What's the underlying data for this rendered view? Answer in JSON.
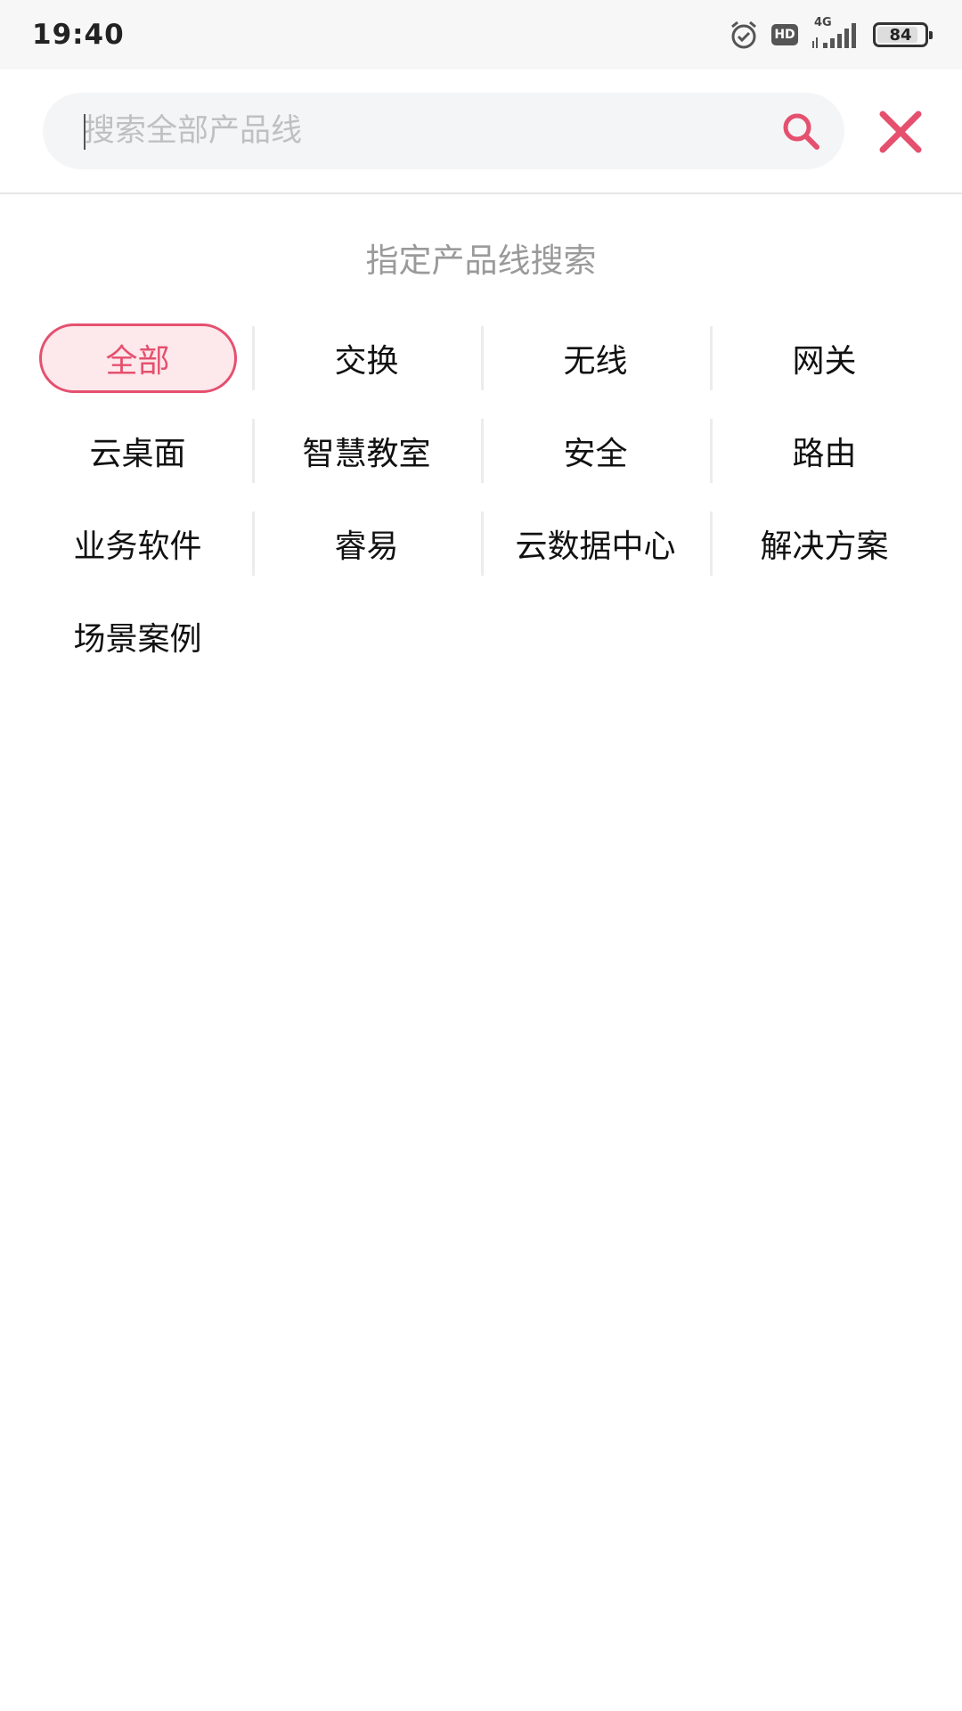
{
  "status_bar": {
    "time": "19:40",
    "network": "4G",
    "hd": "HD",
    "battery": "84",
    "icons": [
      "alarm-icon",
      "hd-icon",
      "signal-icon",
      "battery-icon"
    ]
  },
  "search": {
    "placeholder": "搜索全部产品线",
    "value": ""
  },
  "section": {
    "title": "指定产品线搜索"
  },
  "categories": [
    {
      "label": "全部",
      "active": true
    },
    {
      "label": "交换",
      "active": false
    },
    {
      "label": "无线",
      "active": false
    },
    {
      "label": "网关",
      "active": false
    },
    {
      "label": "云桌面",
      "active": false
    },
    {
      "label": "智慧教室",
      "active": false
    },
    {
      "label": "安全",
      "active": false
    },
    {
      "label": "路由",
      "active": false
    },
    {
      "label": "业务软件",
      "active": false
    },
    {
      "label": "睿易",
      "active": false
    },
    {
      "label": "云数据中心",
      "active": false
    },
    {
      "label": "解决方案",
      "active": false
    },
    {
      "label": "场景案例",
      "active": false
    }
  ],
  "colors": {
    "accent": "#e5506f",
    "accent_bg": "#fde8eb",
    "text": "#111111",
    "muted": "#9a9a9a"
  }
}
